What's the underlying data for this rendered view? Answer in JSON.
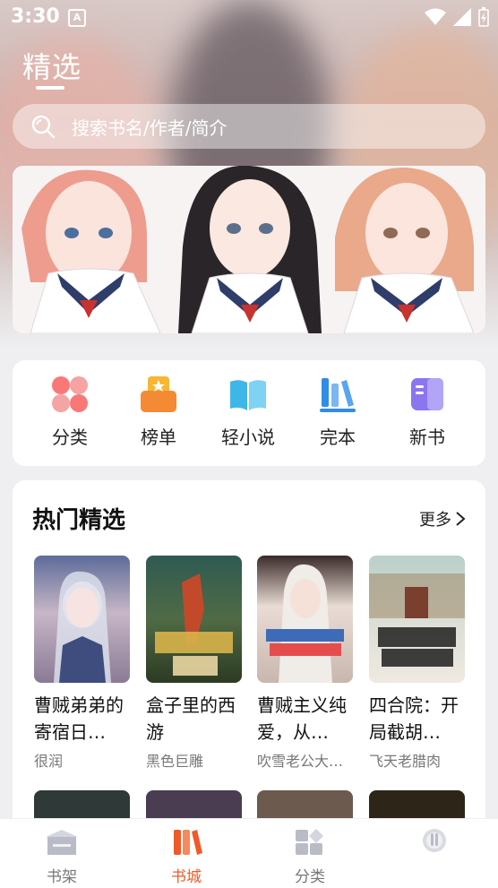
{
  "status_bar": {
    "time": "3:30",
    "notification_badge": "A"
  },
  "header": {
    "title": "精选"
  },
  "search": {
    "placeholder": "搜索书名/作者/简介"
  },
  "quick_nav": {
    "items": [
      {
        "label": "分类",
        "icon": "grid-four-icon"
      },
      {
        "label": "榜单",
        "icon": "trophy-stack-icon"
      },
      {
        "label": "轻小说",
        "icon": "open-book-icon"
      },
      {
        "label": "完本",
        "icon": "bookshelf-icon"
      },
      {
        "label": "新书",
        "icon": "new-book-icon"
      }
    ]
  },
  "hot_picks": {
    "title": "热门精选",
    "more_label": "更多",
    "books": [
      {
        "title": "曹贼弟弟的寄宿日…",
        "author": "很润"
      },
      {
        "title": "盒子里的西游",
        "author": "黑色巨雕"
      },
      {
        "title": "曹贼主义纯爱，从…",
        "author": "吹雪老公大…"
      },
      {
        "title": "四合院：开局截胡…",
        "author": "飞天老腊肉"
      }
    ]
  },
  "tab_bar": {
    "tabs": [
      {
        "label": "书架",
        "active": false
      },
      {
        "label": "书城",
        "active": true
      },
      {
        "label": "分类",
        "active": false
      },
      {
        "label": "",
        "active": false
      }
    ]
  },
  "colors": {
    "accent": "#f05a28",
    "background": "#efeff1"
  }
}
